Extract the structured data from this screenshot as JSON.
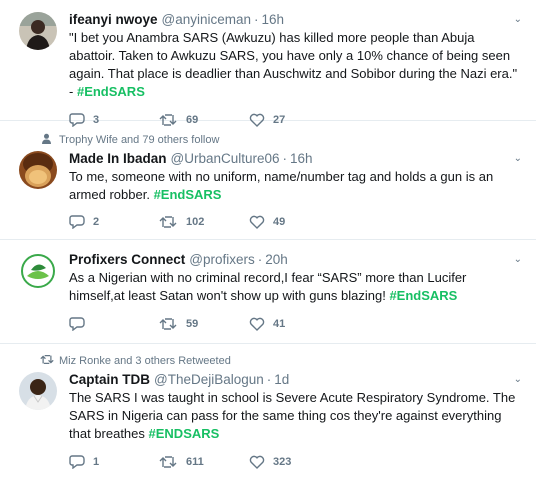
{
  "tweets": [
    {
      "social_context": "",
      "name": "ifeanyi nwoye",
      "handle": "@anyiniceman",
      "time": "16h",
      "text": "\"I bet you Anambra SARS (Awkuzu) has killed more people than Abuja abattoir. Taken to Awkuzu SARS, you have only a 10% chance of being seen again. That place is deadlier than Auschwitz and Sobibor during the Nazi era.\" -",
      "hashtag": "#EndSARS",
      "replies": "3",
      "retweets": "69",
      "likes": "27"
    },
    {
      "social_context": "Trophy Wife and 79 others follow",
      "social_icon": "person-icon",
      "name": "Made In Ibadan",
      "handle": "@UrbanCulture06",
      "time": "16h",
      "text": "To me, someone with no uniform, name/number tag and holds a gun is an armed robber.",
      "hashtag": "#EndSARS",
      "replies": "2",
      "retweets": "102",
      "likes": "49"
    },
    {
      "social_context": "",
      "name": "Profixers Connect",
      "handle": "@profixers",
      "time": "20h",
      "text": "As a Nigerian with no criminal record,I fear “SARS” more than Lucifer himself,at least Satan won't show up with guns blazing!",
      "hashtag": "#EndSARS",
      "replies": "",
      "retweets": "59",
      "likes": "41"
    },
    {
      "social_context": "Miz Ronke and 3 others Retweeted",
      "social_icon": "retweet-icon",
      "name": "Captain TDB",
      "handle": "@TheDejiBalogun",
      "time": "1d",
      "text": "The SARS I was taught in school is Severe Acute Respiratory Syndrome. The SARS in Nigeria can pass for the same thing cos they're against everything that breathes",
      "hashtag": "#ENDSARS",
      "replies": "1",
      "retweets": "611",
      "likes": "323"
    }
  ],
  "symbols": {
    "dot": "·",
    "caret": "⌄"
  },
  "colors": {
    "hashtag": "#17bf63",
    "secondary_text": "#657786",
    "divider": "#e6ecf0"
  }
}
